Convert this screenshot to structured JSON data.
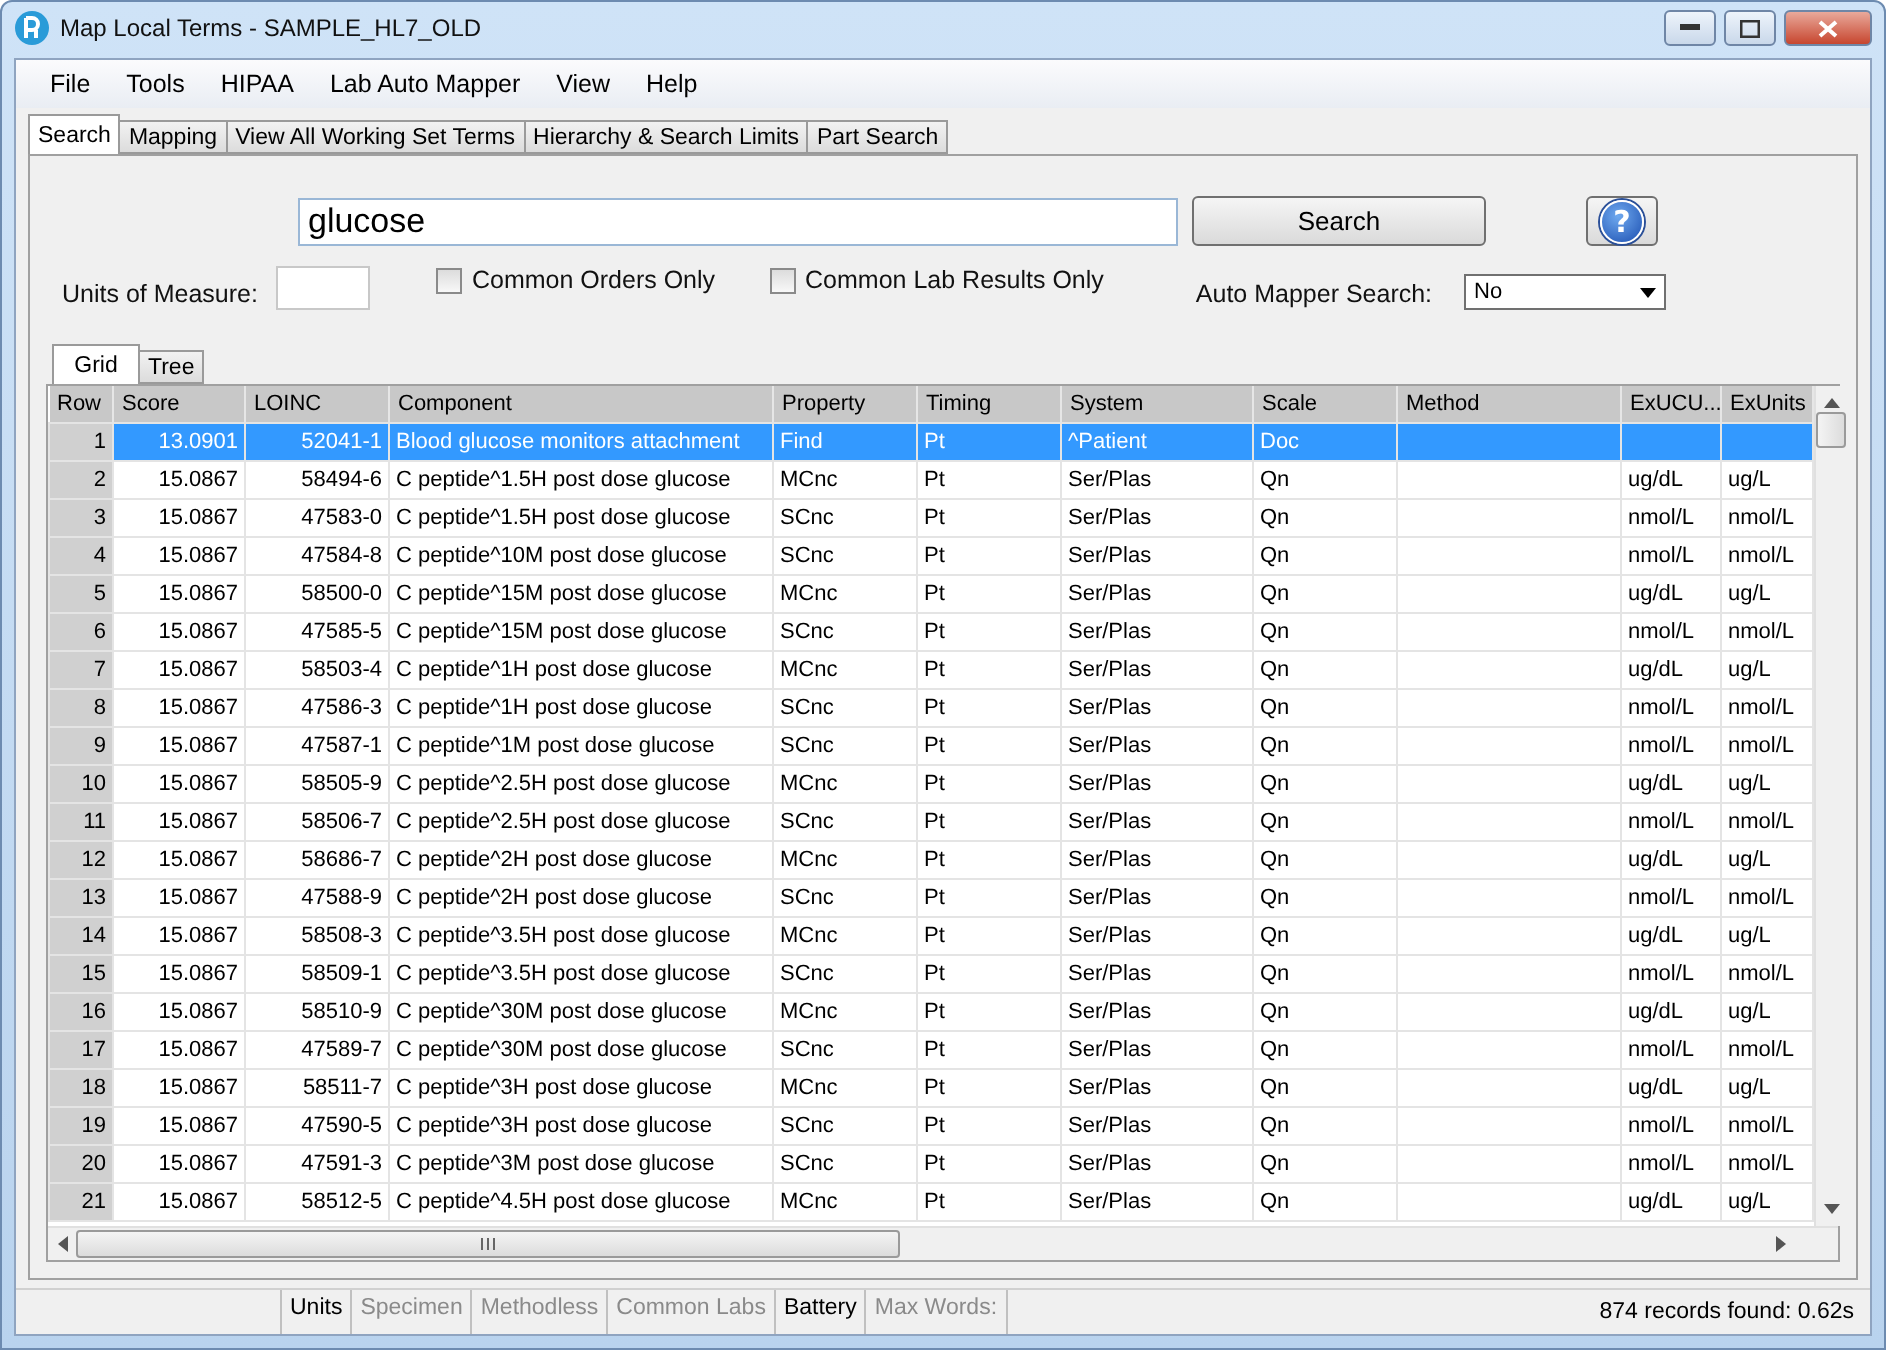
{
  "window": {
    "title": "Map Local Terms - SAMPLE_HL7_OLD"
  },
  "menu": [
    "File",
    "Tools",
    "HIPAA",
    "Lab Auto Mapper",
    "View",
    "Help"
  ],
  "tabs": [
    {
      "label": "Search",
      "selected": true
    },
    {
      "label": "Mapping",
      "selected": false
    },
    {
      "label": "View All Working Set Terms",
      "selected": false
    },
    {
      "label": "Hierarchy & Search Limits",
      "selected": false
    },
    {
      "label": "Part Search",
      "selected": false
    }
  ],
  "search": {
    "value": "glucose ",
    "button": "Search",
    "help": "?"
  },
  "units": {
    "label": "Units of Measure:"
  },
  "options": [
    {
      "label": "Common Orders Only",
      "checked": false
    },
    {
      "label": "Common Lab Results Only",
      "checked": false
    }
  ],
  "auto_mapper": {
    "label": "Auto Mapper Search:",
    "value": "No"
  },
  "view_tabs": [
    {
      "label": "Grid",
      "selected": true
    },
    {
      "label": "Tree",
      "selected": false
    }
  ],
  "table": {
    "columns": [
      "Row",
      "Score",
      "LOINC",
      "Component",
      "Property",
      "Timing",
      "System",
      "Scale",
      "Method",
      "ExUCU...",
      "ExUnits"
    ],
    "rows": [
      {
        "cells": [
          "1",
          "13.0901",
          "52041-1",
          "Blood glucose monitors attachment",
          "Find",
          "Pt",
          "^Patient",
          "Doc",
          null,
          null,
          null
        ],
        "selected": true
      },
      {
        "cells": [
          "2",
          "15.0867",
          "58494-6",
          "C peptide^1.5H post dose glucose",
          "MCnc",
          "Pt",
          "Ser/Plas",
          "Qn",
          null,
          "ug/dL",
          "ug/L"
        ],
        "selected": false
      },
      {
        "cells": [
          "3",
          "15.0867",
          "47583-0",
          "C peptide^1.5H post dose glucose",
          "SCnc",
          "Pt",
          "Ser/Plas",
          "Qn",
          null,
          "nmol/L",
          "nmol/L"
        ],
        "selected": false
      },
      {
        "cells": [
          "4",
          "15.0867",
          "47584-8",
          "C peptide^10M post dose glucose",
          "SCnc",
          "Pt",
          "Ser/Plas",
          "Qn",
          null,
          "nmol/L",
          "nmol/L"
        ],
        "selected": false
      },
      {
        "cells": [
          "5",
          "15.0867",
          "58500-0",
          "C peptide^15M post dose glucose",
          "MCnc",
          "Pt",
          "Ser/Plas",
          "Qn",
          null,
          "ug/dL",
          "ug/L"
        ],
        "selected": false
      },
      {
        "cells": [
          "6",
          "15.0867",
          "47585-5",
          "C peptide^15M post dose glucose",
          "SCnc",
          "Pt",
          "Ser/Plas",
          "Qn",
          null,
          "nmol/L",
          "nmol/L"
        ],
        "selected": false
      },
      {
        "cells": [
          "7",
          "15.0867",
          "58503-4",
          "C peptide^1H post dose glucose",
          "MCnc",
          "Pt",
          "Ser/Plas",
          "Qn",
          null,
          "ug/dL",
          "ug/L"
        ],
        "selected": false
      },
      {
        "cells": [
          "8",
          "15.0867",
          "47586-3",
          "C peptide^1H post dose glucose",
          "SCnc",
          "Pt",
          "Ser/Plas",
          "Qn",
          null,
          "nmol/L",
          "nmol/L"
        ],
        "selected": false
      },
      {
        "cells": [
          "9",
          "15.0867",
          "47587-1",
          "C peptide^1M post dose glucose",
          "SCnc",
          "Pt",
          "Ser/Plas",
          "Qn",
          null,
          "nmol/L",
          "nmol/L"
        ],
        "selected": false
      },
      {
        "cells": [
          "10",
          "15.0867",
          "58505-9",
          "C peptide^2.5H post dose glucose",
          "MCnc",
          "Pt",
          "Ser/Plas",
          "Qn",
          null,
          "ug/dL",
          "ug/L"
        ],
        "selected": false
      },
      {
        "cells": [
          "11",
          "15.0867",
          "58506-7",
          "C peptide^2.5H post dose glucose",
          "SCnc",
          "Pt",
          "Ser/Plas",
          "Qn",
          null,
          "nmol/L",
          "nmol/L"
        ],
        "selected": false
      },
      {
        "cells": [
          "12",
          "15.0867",
          "58686-7",
          "C peptide^2H post dose glucose",
          "MCnc",
          "Pt",
          "Ser/Plas",
          "Qn",
          null,
          "ug/dL",
          "ug/L"
        ],
        "selected": false
      },
      {
        "cells": [
          "13",
          "15.0867",
          "47588-9",
          "C peptide^2H post dose glucose",
          "SCnc",
          "Pt",
          "Ser/Plas",
          "Qn",
          null,
          "nmol/L",
          "nmol/L"
        ],
        "selected": false
      },
      {
        "cells": [
          "14",
          "15.0867",
          "58508-3",
          "C peptide^3.5H post dose glucose",
          "MCnc",
          "Pt",
          "Ser/Plas",
          "Qn",
          null,
          "ug/dL",
          "ug/L"
        ],
        "selected": false
      },
      {
        "cells": [
          "15",
          "15.0867",
          "58509-1",
          "C peptide^3.5H post dose glucose",
          "SCnc",
          "Pt",
          "Ser/Plas",
          "Qn",
          null,
          "nmol/L",
          "nmol/L"
        ],
        "selected": false
      },
      {
        "cells": [
          "16",
          "15.0867",
          "58510-9",
          "C peptide^30M post dose glucose",
          "MCnc",
          "Pt",
          "Ser/Plas",
          "Qn",
          null,
          "ug/dL",
          "ug/L"
        ],
        "selected": false
      },
      {
        "cells": [
          "17",
          "15.0867",
          "47589-7",
          "C peptide^30M post dose glucose",
          "SCnc",
          "Pt",
          "Ser/Plas",
          "Qn",
          null,
          "nmol/L",
          "nmol/L"
        ],
        "selected": false
      },
      {
        "cells": [
          "18",
          "15.0867",
          "58511-7",
          "C peptide^3H post dose glucose",
          "MCnc",
          "Pt",
          "Ser/Plas",
          "Qn",
          null,
          "ug/dL",
          "ug/L"
        ],
        "selected": false
      },
      {
        "cells": [
          "19",
          "15.0867",
          "47590-5",
          "C peptide^3H post dose glucose",
          "SCnc",
          "Pt",
          "Ser/Plas",
          "Qn",
          null,
          "nmol/L",
          "nmol/L"
        ],
        "selected": false
      },
      {
        "cells": [
          "20",
          "15.0867",
          "47591-3",
          "C peptide^3M post dose glucose",
          "SCnc",
          "Pt",
          "Ser/Plas",
          "Qn",
          null,
          "nmol/L",
          "nmol/L"
        ],
        "selected": false
      },
      {
        "cells": [
          "21",
          "15.0867",
          "58512-5",
          "C peptide^4.5H post dose glucose",
          "MCnc",
          "Pt",
          "Ser/Plas",
          "Qn",
          null,
          "ug/dL",
          "ug/L"
        ],
        "selected": false
      }
    ]
  },
  "status_bar": {
    "filters": [
      {
        "label": "Units",
        "disabled": false
      },
      {
        "label": "Specimen",
        "disabled": true
      },
      {
        "label": "Methodless",
        "disabled": true
      },
      {
        "label": "Common Labs",
        "disabled": true
      },
      {
        "label": "Battery",
        "disabled": false
      },
      {
        "label": "Max Words:",
        "disabled": true
      }
    ],
    "summary": "874 records found: 0.62s"
  }
}
